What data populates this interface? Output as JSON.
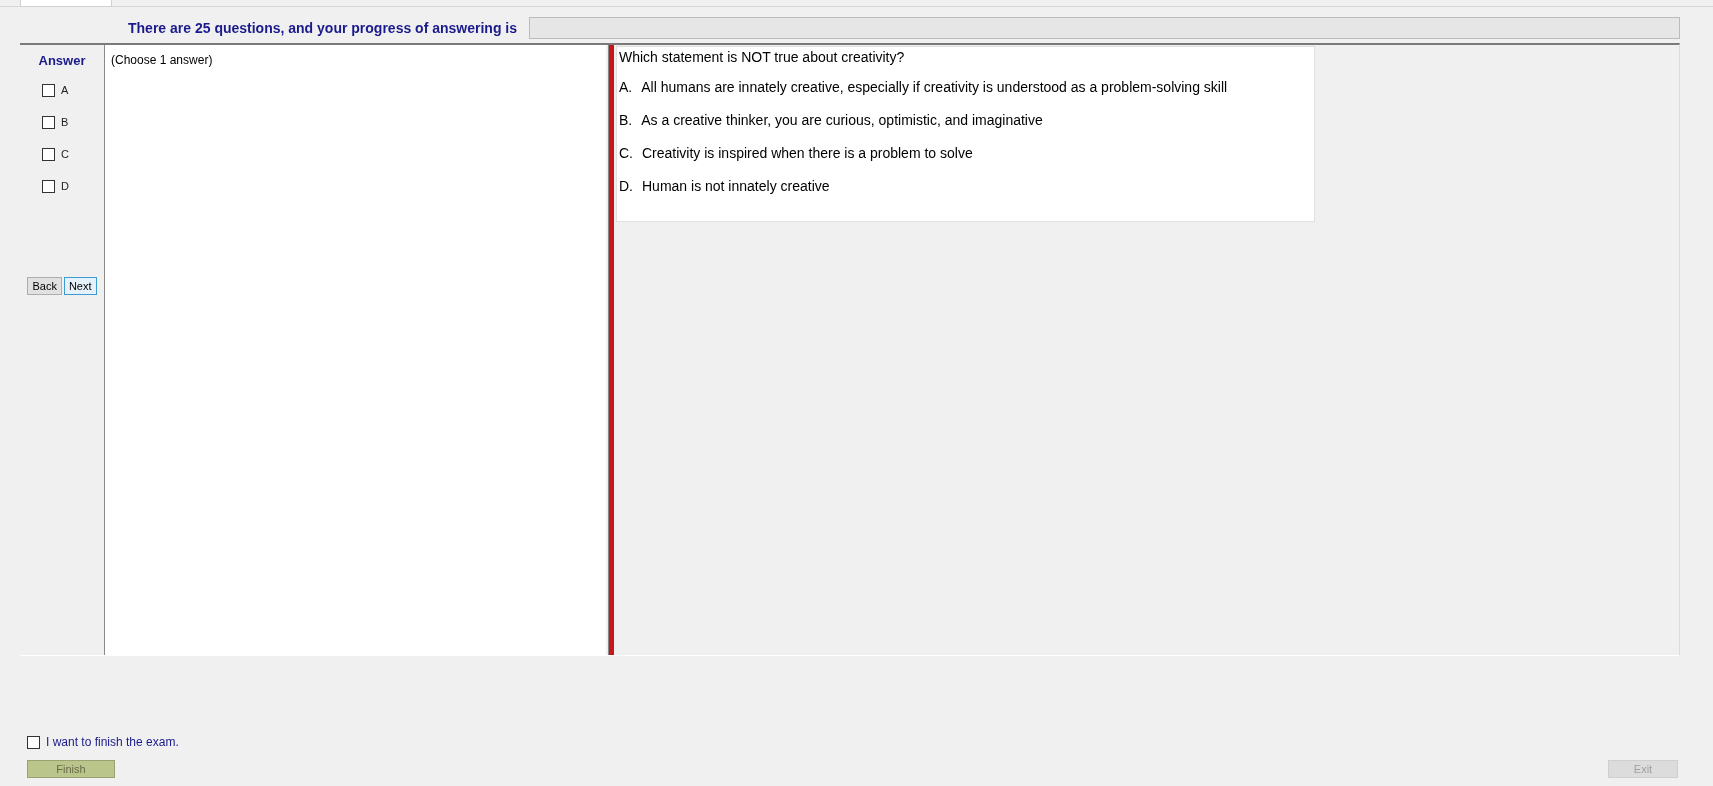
{
  "header": {
    "text": "There are 25 questions, and your progress of answering is",
    "progress": {
      "level": 0
    }
  },
  "answer": {
    "title": "Answer",
    "options": [
      {
        "label": "A",
        "checked": false
      },
      {
        "label": "B",
        "checked": false
      },
      {
        "label": "C",
        "checked": false
      },
      {
        "label": "D",
        "checked": false
      }
    ]
  },
  "nav": {
    "back": "Back",
    "next": "Next"
  },
  "choose_hint": "(Choose 1 answer)",
  "question": {
    "text": "Which statement is NOT true about creativity?",
    "choices": [
      {
        "letter": "A.",
        "text": "All humans are innately creative, especially if creativity is understood as a problem-solving skill"
      },
      {
        "letter": "B.",
        "text": "As a creative thinker, you are curious, optimistic, and imaginative"
      },
      {
        "letter": "C.",
        "text": "Creativity is inspired when there is a problem to solve"
      },
      {
        "letter": "D.",
        "text": "Human is not innately creative"
      }
    ]
  },
  "finish": {
    "label": "I want to finish the exam.",
    "checked": false,
    "button": "Finish",
    "button_disabled": true
  },
  "exit": {
    "label": "Exit",
    "disabled": true
  }
}
